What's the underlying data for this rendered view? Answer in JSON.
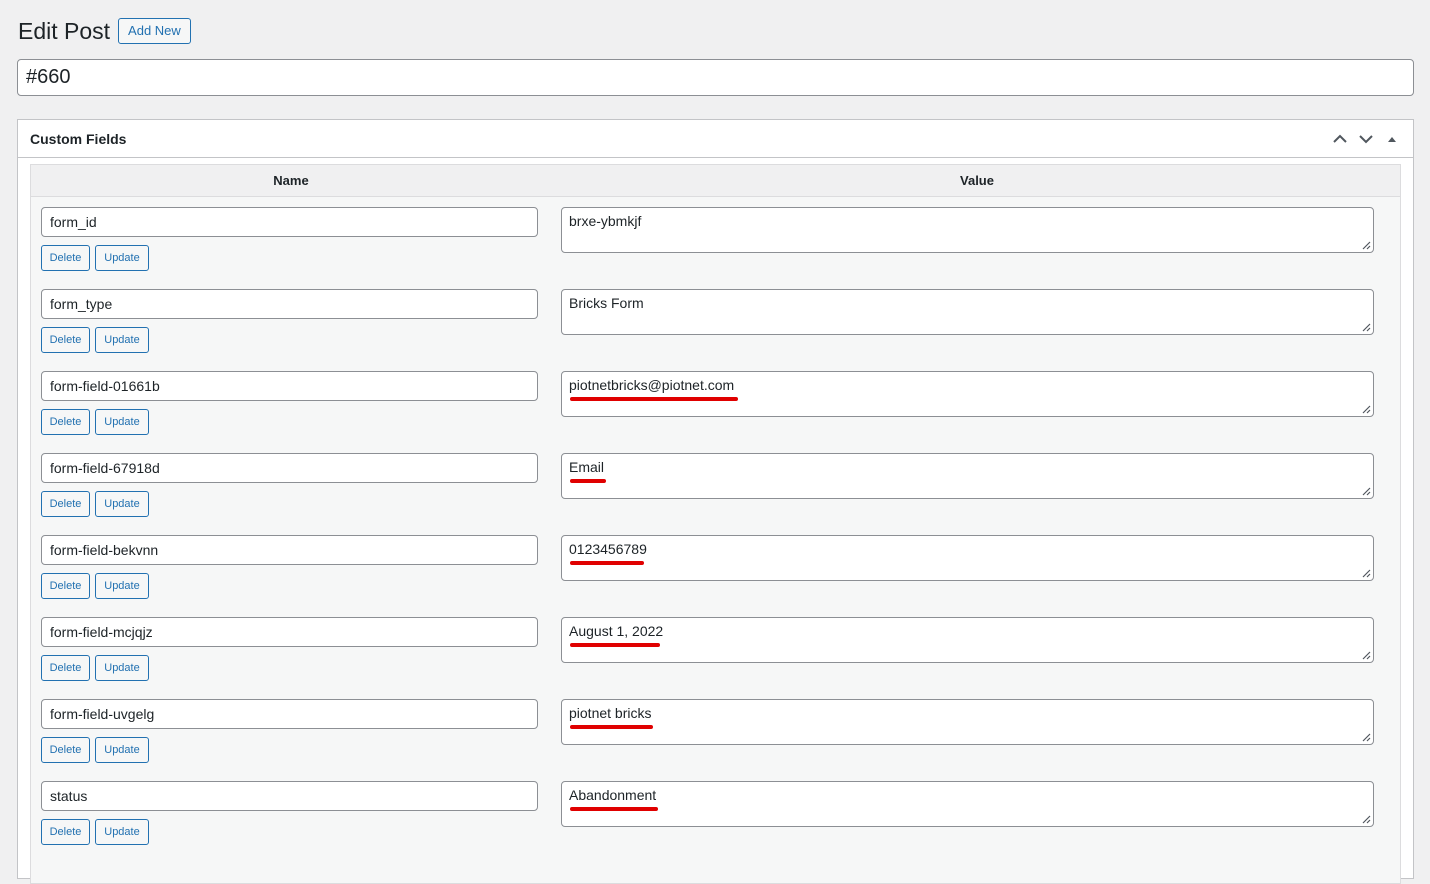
{
  "header": {
    "title": "Edit Post",
    "add_new_label": "Add New"
  },
  "post": {
    "title_value": "#660"
  },
  "custom_fields": {
    "box_title": "Custom Fields",
    "columns": {
      "name": "Name",
      "value": "Value"
    },
    "delete_label": "Delete",
    "update_label": "Update",
    "highlight_color": "#e00000",
    "rows": [
      {
        "name": "form_id",
        "value": "brxe-ybmkjf",
        "highlighted": false
      },
      {
        "name": "form_type",
        "value": "Bricks Form",
        "highlighted": false
      },
      {
        "name": "form-field-01661b",
        "value": "piotnetbricks@piotnet.com",
        "highlighted": true
      },
      {
        "name": "form-field-67918d",
        "value": "Email",
        "highlighted": true
      },
      {
        "name": "form-field-bekvnn",
        "value": "0123456789",
        "highlighted": true
      },
      {
        "name": "form-field-mcjqjz",
        "value": "August 1, 2022",
        "highlighted": true
      },
      {
        "name": "form-field-uvgelg",
        "value": "piotnet bricks",
        "highlighted": true
      },
      {
        "name": "status",
        "value": "Abandonment",
        "highlighted": true
      }
    ]
  }
}
